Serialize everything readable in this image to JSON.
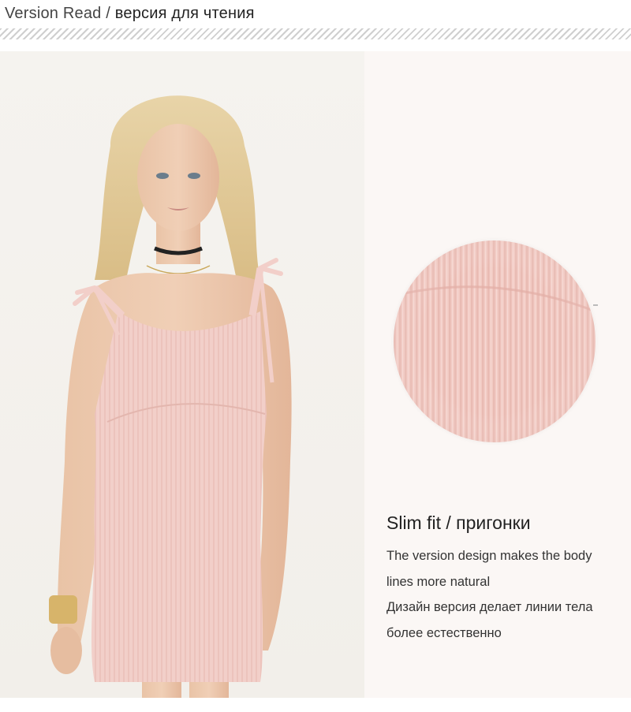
{
  "header": {
    "title_en": "Version Read /",
    "title_ru": "версия для чтения"
  },
  "info": {
    "heading": "Slim fit / пригонки",
    "lines": [
      "The version design makes the body",
      "lines more natural",
      "Дизайн версия делает линии тела",
      "более естественно"
    ]
  },
  "colors": {
    "dress": "#f2cfc9",
    "panel_bg": "#fbf7f5",
    "fabric": "#f0c9c2"
  },
  "icons": {
    "fabric_swatch": "ribbed-knit-fabric-closeup",
    "model_photo": "model-in-pink-ribbed-mini-dress"
  }
}
